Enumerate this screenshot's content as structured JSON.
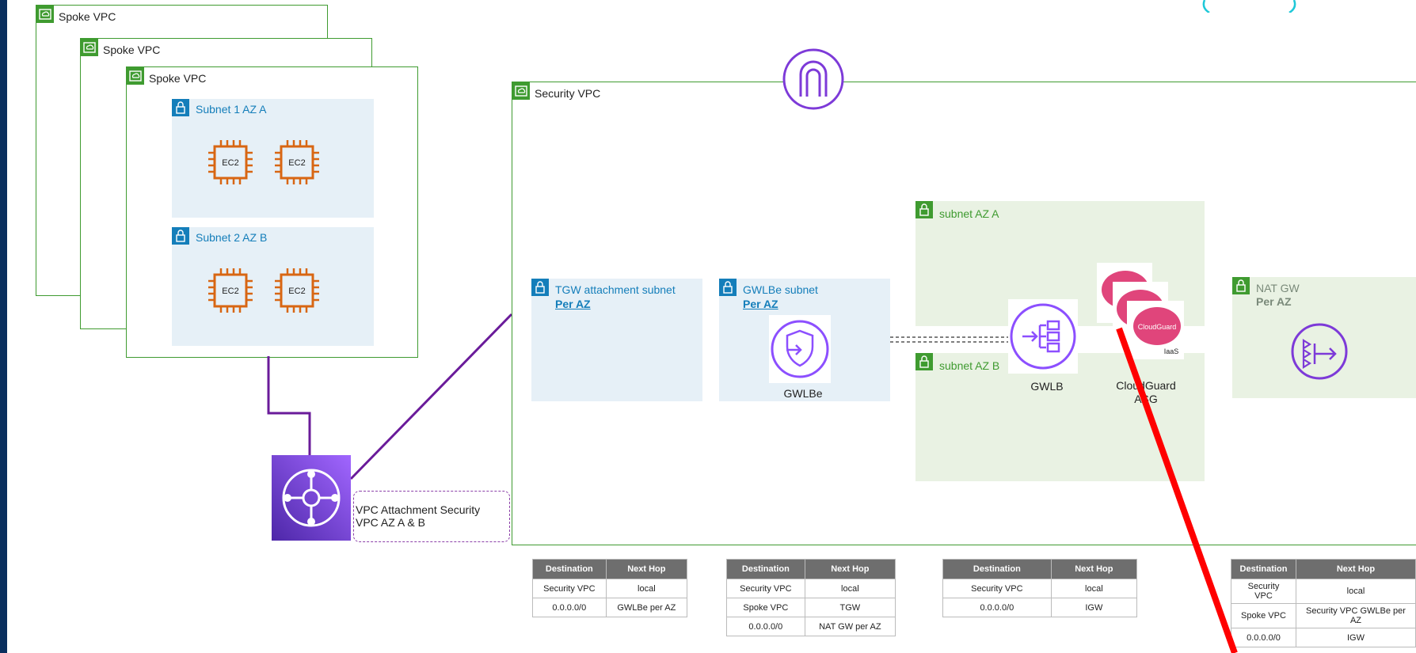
{
  "vpcs": {
    "spoke_back": "Spoke VPC",
    "spoke_mid": "Spoke VPC",
    "spoke_front": "Spoke VPC",
    "security": "Security VPC"
  },
  "subnets": {
    "spoke_a": "Subnet 1 AZ A",
    "spoke_b": "Subnet 2 AZ B",
    "tgw": "TGW attachment subnet",
    "tgw_per_az": "Per AZ",
    "gwlbe": "GWLBe subnet",
    "gwlbe_per_az": "Per AZ",
    "az_a": "subnet AZ A",
    "az_b": "subnet AZ B",
    "nat": "NAT GW",
    "nat_per_az": "Per AZ"
  },
  "ec2": [
    "EC2",
    "EC2",
    "EC2",
    "EC2"
  ],
  "icons": {
    "gwlbe": "GWLBe",
    "gwlb": "GWLB",
    "cloudguard_line1": "CloudGuard",
    "cloudguard_line2": "ASG",
    "cloudguard_card": "CloudGuard",
    "iaas": "IaaS",
    "attachment_line1": "VPC Attachment Security",
    "attachment_line2": "VPC AZ A & B"
  },
  "route_tables": [
    {
      "headers": [
        "Destination",
        "Next Hop"
      ],
      "rows": [
        [
          "Security VPC",
          "local"
        ],
        [
          "0.0.0.0/0",
          "GWLBe per AZ"
        ]
      ]
    },
    {
      "headers": [
        "Destination",
        "Next Hop"
      ],
      "rows": [
        [
          "Security VPC",
          "local"
        ],
        [
          "Spoke VPC",
          "TGW"
        ],
        [
          "0.0.0.0/0",
          "NAT GW per AZ"
        ]
      ]
    },
    {
      "headers": [
        "Destination",
        "Next Hop"
      ],
      "rows": [
        [
          "Security VPC",
          "local"
        ],
        [
          "0.0.0.0/0",
          "IGW"
        ]
      ]
    },
    {
      "headers": [
        "Destination",
        "Next Hop"
      ],
      "rows": [
        [
          "Security VPC",
          "local"
        ],
        [
          "Spoke VPC",
          "Security VPC GWLBe per AZ"
        ],
        [
          "0.0.0.0/0",
          "IGW"
        ]
      ]
    }
  ],
  "colors": {
    "vpc_border": "#3f9b30",
    "subnet_blue": "#e6f0f7",
    "subnet_green": "#e9f2e3",
    "ec2_orange": "#d86613",
    "purple": "#8c4fff",
    "tgw_purple": "#7d3ad8",
    "cloudguard_pink": "#e0457b",
    "arrow_red": "#ff0000",
    "page_border": "#0a2f5e"
  }
}
